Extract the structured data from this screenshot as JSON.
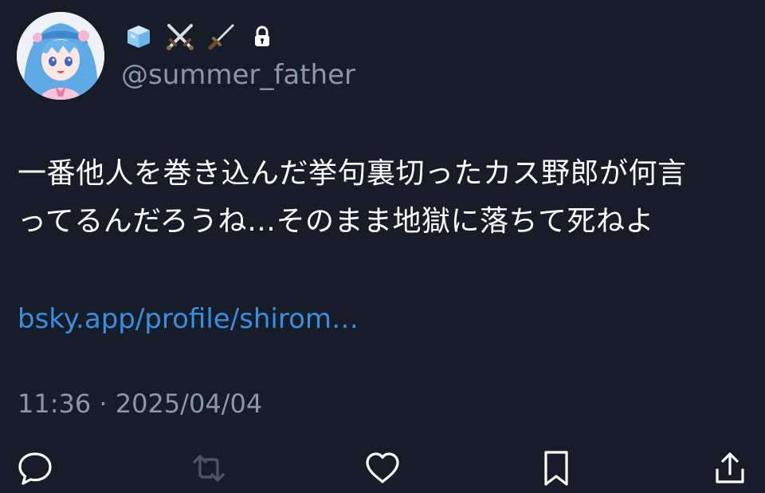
{
  "author": {
    "display_name_icons": [
      "ice-cube-icon",
      "crossed-swords-icon",
      "dagger-icon"
    ],
    "locked": true,
    "handle": "@summer_father"
  },
  "post": {
    "text_lines": [
      "一番他人を巻き込んだ挙句裏切ったカス野郎が何言",
      "ってるんだろうね…そのまま地獄に落ちて死ねよ"
    ],
    "link_text": "bsky.app/profile/shirom…",
    "timestamp": "11:36 · 2025/04/04"
  },
  "actions": [
    "reply",
    "repost",
    "like",
    "bookmark",
    "share"
  ],
  "colors": {
    "background": "#161d29",
    "text": "#ffffff",
    "muted": "#8b96a6",
    "link": "#3b8ddf",
    "repost_disabled": "#4a5466"
  }
}
